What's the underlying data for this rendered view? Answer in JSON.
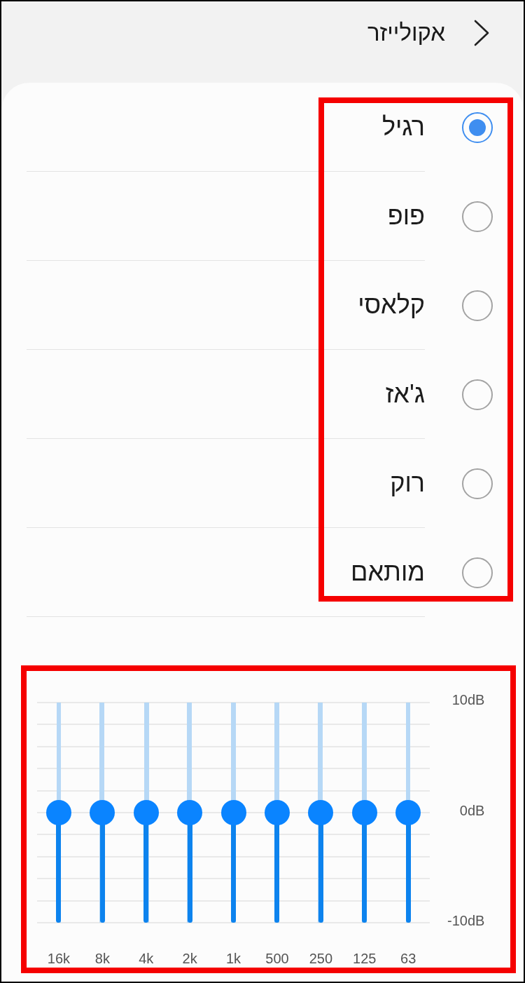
{
  "header": {
    "title": "אקולייזר"
  },
  "presets": {
    "highlighted": true,
    "items": [
      {
        "label": "רגיל",
        "selected": true
      },
      {
        "label": "פופ",
        "selected": false
      },
      {
        "label": "קלאסי",
        "selected": false
      },
      {
        "label": "ג'אז",
        "selected": false
      },
      {
        "label": "רוק",
        "selected": false
      },
      {
        "label": "מותאם",
        "selected": false
      }
    ]
  },
  "equalizer": {
    "highlighted": true,
    "scale": [
      "10dB",
      "0dB",
      "-10dB"
    ],
    "bands": [
      {
        "label": "63",
        "level": 0.5
      },
      {
        "label": "125",
        "level": 0.5
      },
      {
        "label": "250",
        "level": 0.5
      },
      {
        "label": "500",
        "level": 0.5
      },
      {
        "label": "1k",
        "level": 0.5
      },
      {
        "label": "2k",
        "level": 0.5
      },
      {
        "label": "4k",
        "level": 0.5
      },
      {
        "label": "8k",
        "level": 0.5
      },
      {
        "label": "16k",
        "level": 0.5
      }
    ]
  }
}
